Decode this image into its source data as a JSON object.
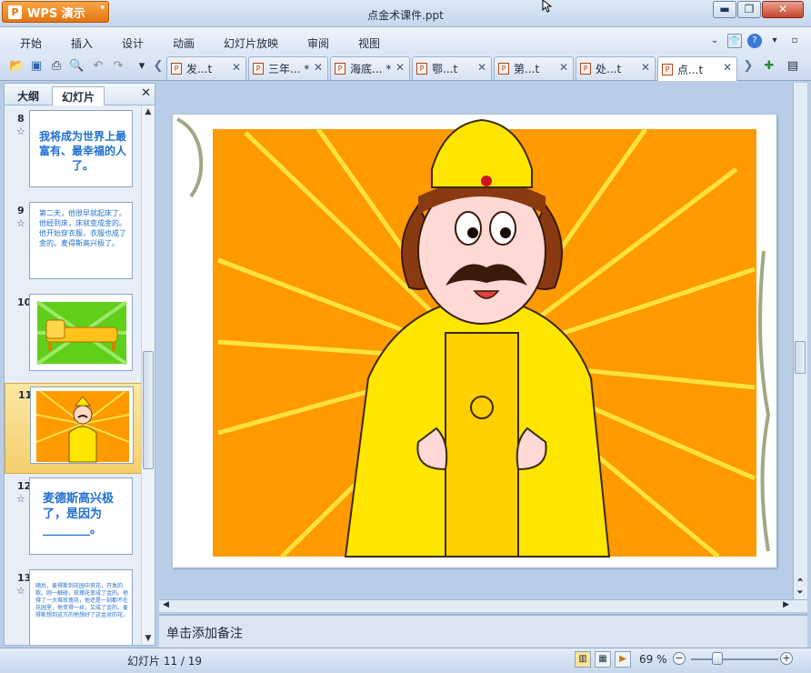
{
  "app": {
    "name": "WPS 演示",
    "logo_glyph": "P",
    "window_title": "点金术课件.ppt"
  },
  "menu": [
    "开始",
    "插入",
    "设计",
    "动画",
    "幻灯片放映",
    "审阅",
    "视图"
  ],
  "doc_tabs": [
    {
      "label": "发...t"
    },
    {
      "label": "三年... *"
    },
    {
      "label": "海底... *"
    },
    {
      "label": "鄂...t"
    },
    {
      "label": "第...t"
    },
    {
      "label": "处...t"
    },
    {
      "label": "点...t"
    }
  ],
  "panel": {
    "tab_outline": "大纲",
    "tab_slides": "幻灯片"
  },
  "thumbnails": [
    {
      "num": "8",
      "text": "我将成为世界上最富有、最幸福的人了。"
    },
    {
      "num": "9",
      "text": "第二天，他很早就起床了。他经到床，床就变成金的。他开始穿衣服，衣服也成了金的。麦得斯高兴极了。"
    },
    {
      "num": "10",
      "text": ""
    },
    {
      "num": "11",
      "text": ""
    },
    {
      "num": "12",
      "text": "麦德斯高兴极了，是因为________。"
    },
    {
      "num": "13",
      "text": "随后，麦得斯到花园中赏花，开发的歌。刚一触碰，玫瑰花变成了金的。他得了一大堆玫瑰花，他还是一刻都不在花园里，他变得一丝，又成了金的。麦得斯想到这方的他想好了这金对的花。"
    }
  ],
  "highlight_word": "很早",
  "notes_placeholder": "单击添加备注",
  "status": {
    "slide_counter": "幻灯片 11 / 19",
    "zoom": "69 %"
  },
  "colors": {
    "accent": "#e4750f",
    "slide_bg": "#ff9a00"
  }
}
